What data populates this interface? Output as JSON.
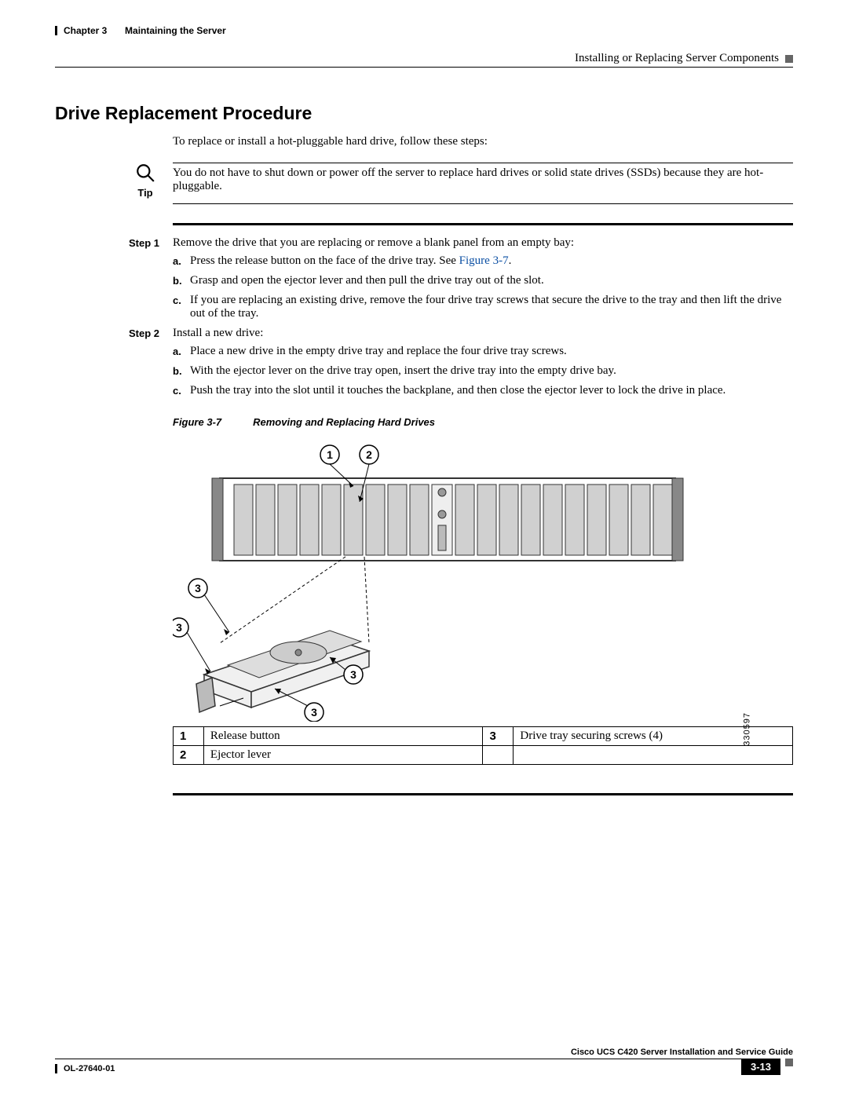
{
  "header": {
    "chapter_label": "Chapter 3",
    "chapter_title": "Maintaining the Server",
    "section_title": "Installing or Replacing Server Components"
  },
  "section_heading": "Drive Replacement Procedure",
  "intro_text": "To replace or install a hot-pluggable hard drive, follow these steps:",
  "tip": {
    "label": "Tip",
    "text": "You do not have to shut down or power off the server to replace hard drives or solid state drives (SSDs) because they are hot-pluggable."
  },
  "steps": [
    {
      "label": "Step 1",
      "text": "Remove the drive that you are replacing or remove a blank panel from an empty bay:",
      "subs": [
        {
          "letter": "a.",
          "text_before": "Press the release button on the face of the drive tray. See ",
          "link": "Figure 3-7",
          "text_after": "."
        },
        {
          "letter": "b.",
          "text": "Grasp and open the ejector lever and then pull the drive tray out of the slot."
        },
        {
          "letter": "c.",
          "text": "If you are replacing an existing drive, remove the four drive tray screws that secure the drive to the tray and then lift the drive out of the tray."
        }
      ]
    },
    {
      "label": "Step 2",
      "text": "Install a new drive:",
      "subs": [
        {
          "letter": "a.",
          "text": "Place a new drive in the empty drive tray and replace the four drive tray screws."
        },
        {
          "letter": "b.",
          "text": "With the ejector lever on the drive tray open, insert the drive tray into the empty drive bay."
        },
        {
          "letter": "c.",
          "text": "Push the tray into the slot until it touches the backplane, and then close the ejector lever to lock the drive in place."
        }
      ]
    }
  ],
  "figure": {
    "number": "Figure 3-7",
    "title": "Removing and Replacing Hard Drives",
    "id": "330597",
    "callouts": [
      "1",
      "2",
      "3",
      "3",
      "3",
      "3"
    ]
  },
  "legend": [
    {
      "num": "1",
      "desc": "Release button",
      "num2": "3",
      "desc2": "Drive tray securing screws (4)"
    },
    {
      "num": "2",
      "desc": "Ejector lever",
      "num2": "",
      "desc2": ""
    }
  ],
  "footer": {
    "guide_title": "Cisco UCS C420 Server Installation and Service Guide",
    "doc_id": "OL-27640-01",
    "page": "3-13"
  }
}
